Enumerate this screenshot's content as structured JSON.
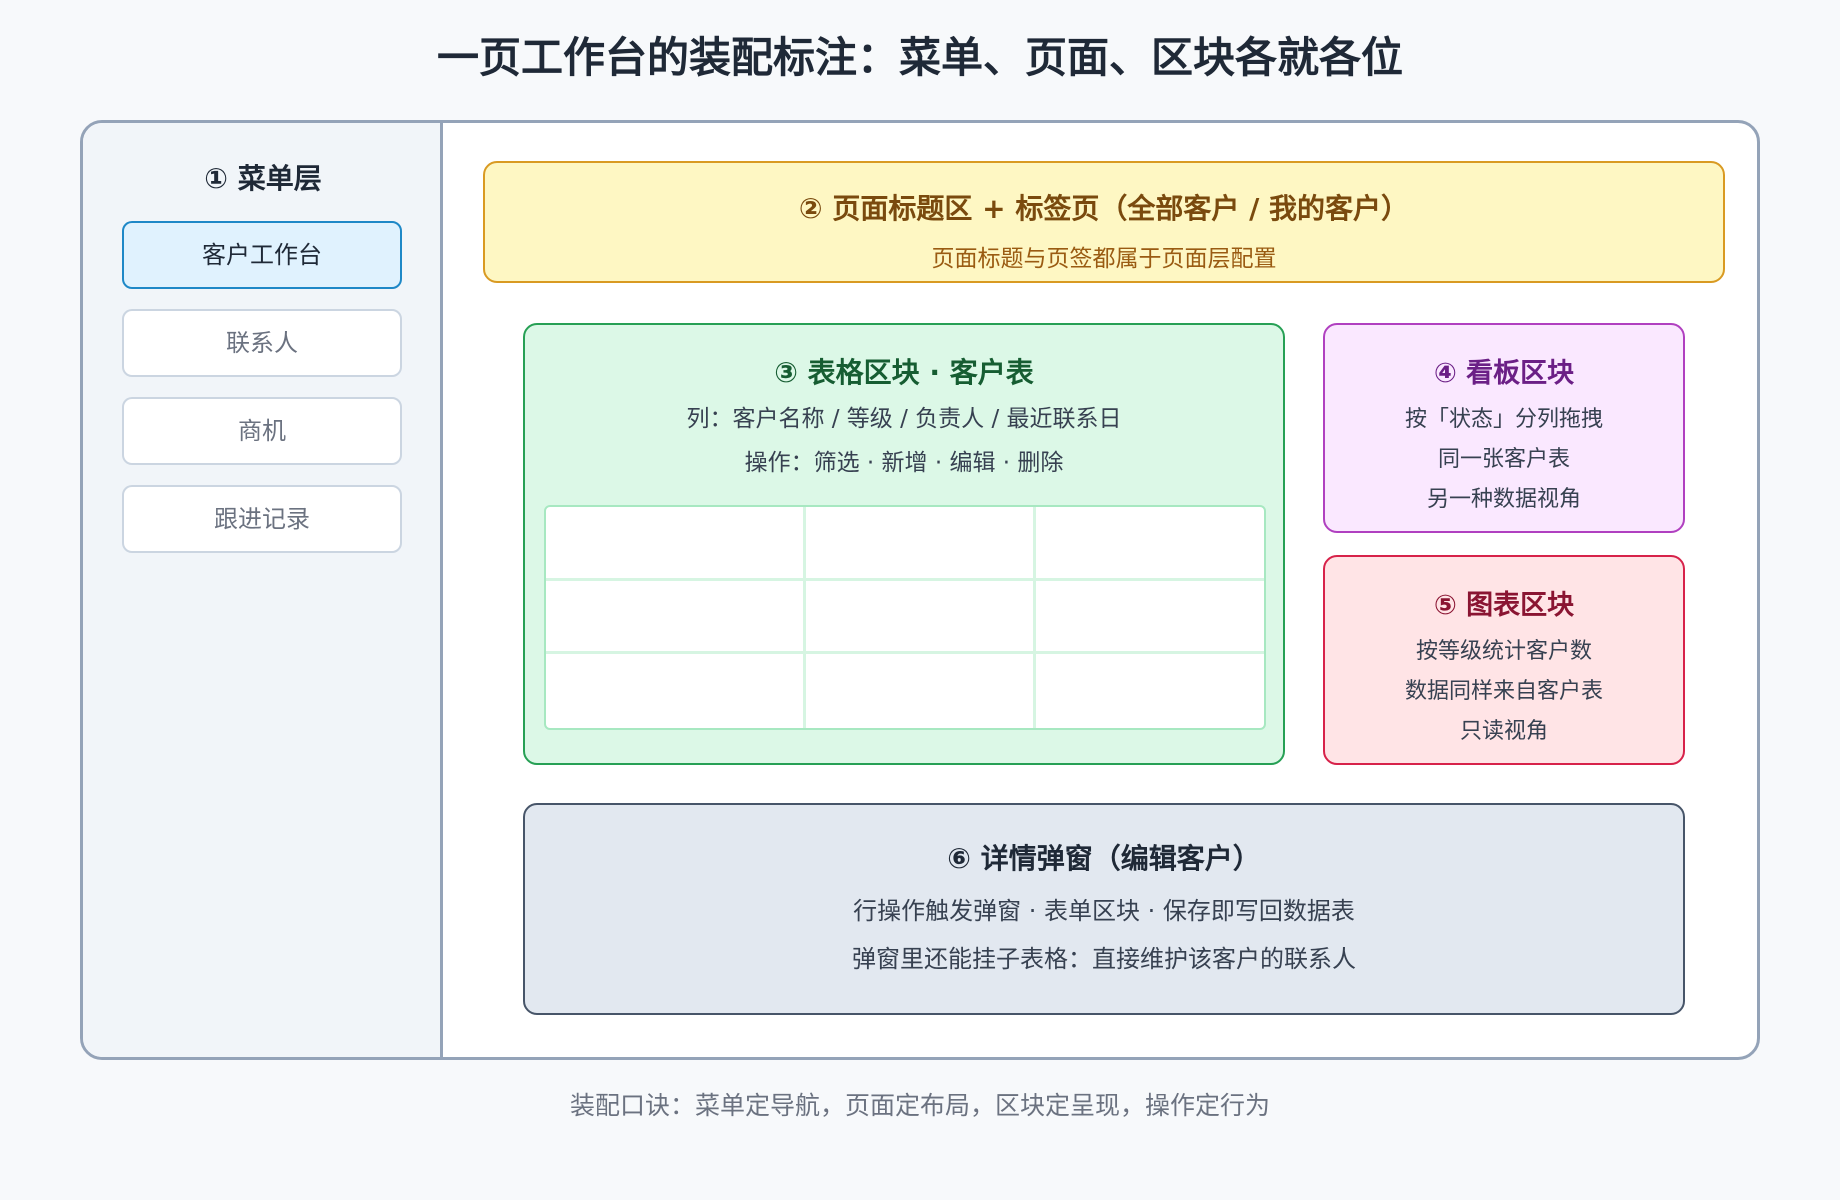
{
  "title": "一页工作台的装配标注：菜单、页面、区块各就各位",
  "sidebar": {
    "title": "① 菜单层",
    "items": [
      {
        "label": "客户工作台",
        "active": true
      },
      {
        "label": "联系人",
        "active": false
      },
      {
        "label": "商机",
        "active": false
      },
      {
        "label": "跟进记录",
        "active": false
      }
    ]
  },
  "page_header": {
    "title": "② 页面标题区 + 标签页（全部客户 / 我的客户）",
    "subtitle": "页面标题与页签都属于页面层配置"
  },
  "table_block": {
    "title": "③ 表格区块 · 客户表",
    "columns_line": "列：客户名称 / 等级 / 负责人 / 最近联系日",
    "actions_line": "操作：筛选 · 新增 · 编辑 · 删除"
  },
  "kanban_block": {
    "title": "④ 看板区块",
    "lines": [
      "按「状态」分列拖拽",
      "同一张客户表",
      "另一种数据视角"
    ]
  },
  "chart_block": {
    "title": "⑤ 图表区块",
    "lines": [
      "按等级统计客户数",
      "数据同样来自客户表",
      "只读视角"
    ]
  },
  "modal_block": {
    "title": "⑥ 详情弹窗（编辑客户）",
    "lines": [
      "行操作触发弹窗 · 表单区块 · 保存即写回数据表",
      "弹窗里还能挂子表格：直接维护该客户的联系人"
    ]
  },
  "footer": "装配口诀：菜单定导航，页面定布局，区块定呈现，操作定行为",
  "colors": {
    "menu_active": "#1e88c7",
    "page_header": "#d99a22",
    "table_block": "#27a055",
    "kanban_block": "#b040c0",
    "chart_block": "#d7224a",
    "modal_block": "#475569"
  }
}
